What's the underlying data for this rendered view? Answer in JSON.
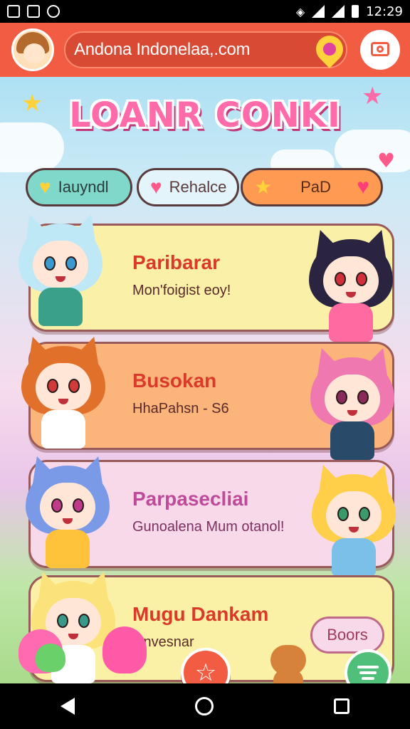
{
  "status": {
    "time": "12:29",
    "left_icons": [
      "notification-icon",
      "photo-icon",
      "gear-icon"
    ],
    "right_icons": [
      "vibrate-icon",
      "wifi-icon",
      "signal-icon",
      "battery-icon"
    ]
  },
  "topbar": {
    "url": "Andona Indonelaa,.com",
    "accent": "#f25c42"
  },
  "banner": {
    "title": "LOANR CONKI"
  },
  "tabs": [
    {
      "label": "Iauyndl",
      "icon": "heart-icon"
    },
    {
      "label": "Rehalce",
      "icon": "heart-icon"
    },
    {
      "label": "PaD",
      "icon": "star-icon"
    }
  ],
  "cards": [
    {
      "title": "Paribarar",
      "subtitle": "Mon'foigist eoy!"
    },
    {
      "title": "Busokan",
      "subtitle": "HhaPahsn - S6"
    },
    {
      "title": "Parpasecliai",
      "subtitle": "Gunoalena Mum otanol!"
    },
    {
      "title": "Mugu Dankam",
      "subtitle": "Gnvesnar"
    }
  ],
  "card4_button": "Boors"
}
